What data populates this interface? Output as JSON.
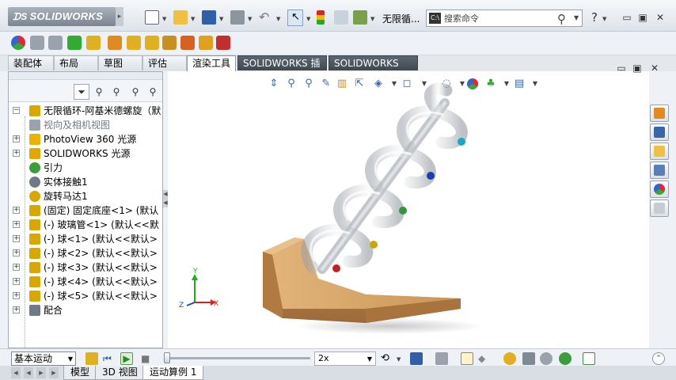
{
  "app": {
    "logo": "SOLIDWORKS",
    "document_title": "无限循...",
    "search": {
      "placeholder": "搜索命令"
    }
  },
  "command_tabs": [
    {
      "label": "装配体"
    },
    {
      "label": "布局"
    },
    {
      "label": "草图"
    },
    {
      "label": "评估"
    },
    {
      "label": "渲染工具",
      "active": true
    },
    {
      "label": "SOLIDWORKS 插件"
    },
    {
      "label": "SOLIDWORKS MBD"
    }
  ],
  "feature_tree": {
    "rows": [
      {
        "label": "无限循环-阿基米德螺旋（默",
        "icon": "assembly-icon",
        "icon_color": "#d8a800",
        "expand": "−"
      },
      {
        "label": "视向及相机视图",
        "icon": "camera-icon",
        "icon_color": "#9aa3ad",
        "expand": "",
        "gray": true
      },
      {
        "label": "PhotoView 360 光源",
        "icon": "light-icon",
        "icon_color": "#e8b400",
        "expand": "+"
      },
      {
        "label": "SOLIDWORKS 光源",
        "icon": "light-icon",
        "icon_color": "#e0a800",
        "expand": "+"
      },
      {
        "label": "引力",
        "icon": "gravity-icon",
        "icon_color": "#3a9e3a",
        "expand": ""
      },
      {
        "label": "实体接触1",
        "icon": "contact-icon",
        "icon_color": "#6f7a84",
        "expand": ""
      },
      {
        "label": "旋转马达1",
        "icon": "motor-icon",
        "icon_color": "#d8a800",
        "expand": ""
      },
      {
        "label": "(固定) 固定底座<1> (默认",
        "icon": "part-icon",
        "icon_color": "#d8a800",
        "expand": "+"
      },
      {
        "label": "(-) 玻璃管<1> (默认<<默",
        "icon": "part-icon",
        "icon_color": "#d8a800",
        "expand": "+"
      },
      {
        "label": "(-) 球<1> (默认<<默认>",
        "icon": "part-icon",
        "icon_color": "#d8a800",
        "expand": "+"
      },
      {
        "label": "(-) 球<2> (默认<<默认>",
        "icon": "part-icon",
        "icon_color": "#d8a800",
        "expand": "+"
      },
      {
        "label": "(-) 球<3> (默认<<默认>",
        "icon": "part-icon",
        "icon_color": "#d8a800",
        "expand": "+"
      },
      {
        "label": "(-) 球<4> (默认<<默认>",
        "icon": "part-icon",
        "icon_color": "#d8a800",
        "expand": "+"
      },
      {
        "label": "(-) 球<5> (默认<<默认>",
        "icon": "part-icon",
        "icon_color": "#d8a800",
        "expand": "+"
      },
      {
        "label": "配合",
        "icon": "mates-icon",
        "icon_color": "#6f7a84",
        "expand": "+"
      }
    ]
  },
  "viewport": {
    "triad": {
      "x": "X",
      "y": "Y",
      "z": "Z"
    },
    "colors": {
      "wood": "#d8a86a",
      "glass": "#c8ccd2",
      "ball_cyan": "#1aa6c8",
      "ball_blue": "#1a3fb0",
      "ball_green": "#2e9a2e",
      "ball_yellow": "#c8a800",
      "ball_red": "#c81e1e"
    }
  },
  "motion_study": {
    "type": "基本运动",
    "speed": "2x",
    "slider_position": 0
  },
  "bottom_tabs": [
    {
      "label": "模型"
    },
    {
      "label": "3D 视图"
    },
    {
      "label": "运动算例 1",
      "active": true
    }
  ]
}
